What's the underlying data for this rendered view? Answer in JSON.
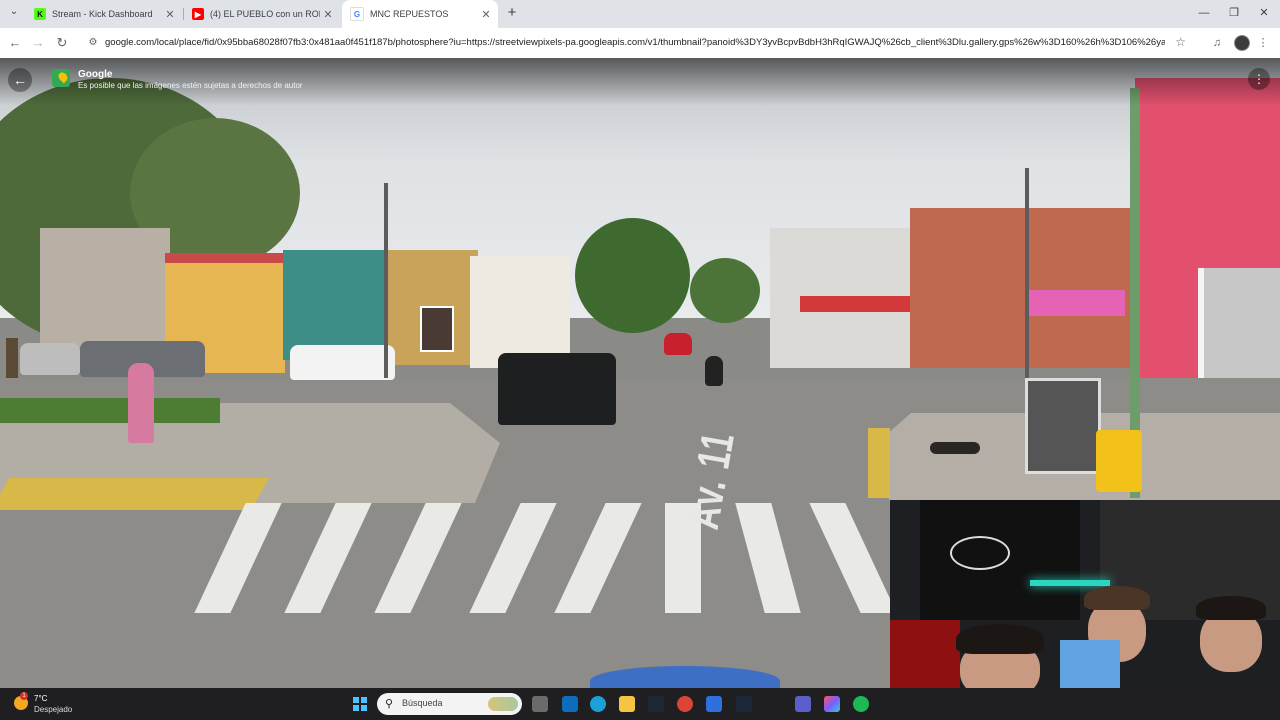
{
  "browser": {
    "tabs": [
      {
        "title": "Stream - Kick Dashboard",
        "favicon": "kick-icon",
        "favicon_color": "#53fc18",
        "active": false
      },
      {
        "title": "(4) EL PUEBLO con un ROBOT tr",
        "favicon": "youtube-icon",
        "favicon_color": "#ff0000",
        "active": false
      },
      {
        "title": "MNC REPUESTOS",
        "favicon": "google-icon",
        "favicon_color": "#4285f4",
        "active": true
      }
    ],
    "new_tab_glyph": "+",
    "url": "google.com/local/place/fid/0x95bba68028f07fb3:0x481aa0f451f187b/photosphere?iu=https://streetviewpixels-pa.googleapis.com/v1/thumbnail?panoid%3DY3yvBcpvBdbH3hRqIGWAJQ%26cb_client%3Dlu.gallery.gps%26w%3D160%26h%3D106%26yaw%3D..."
  },
  "streetview": {
    "title": "Google",
    "subtitle": "Es posible que las imágenes estén sujetas a derechos de autor",
    "road_marking": "Av. 11"
  },
  "taskbar": {
    "temperature": "7°C",
    "condition": "Despejado",
    "weather_badge": "1",
    "search_label": "Búsqueda",
    "accent_color": "#4cc2ff"
  }
}
